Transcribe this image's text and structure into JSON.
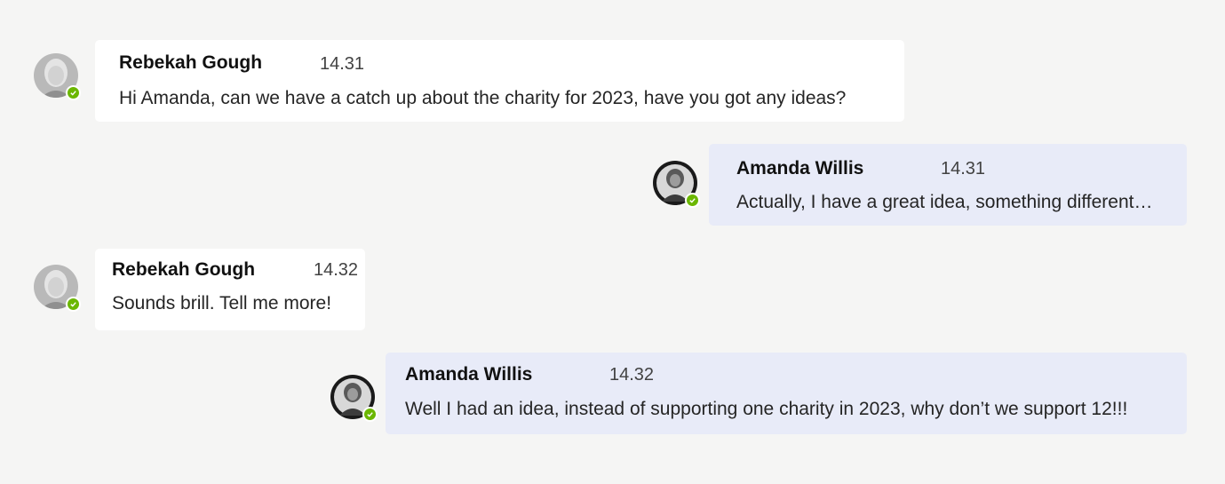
{
  "messages": [
    {
      "sender": "Rebekah Gough",
      "time": "14.31",
      "text": "Hi Amanda, can we have a catch up about the charity for 2023, have you got any ideas?",
      "status": "available"
    },
    {
      "sender": "Amanda Willis",
      "time": "14.31",
      "text": "Actually, I have a great idea, something different…",
      "status": "available"
    },
    {
      "sender": "Rebekah Gough",
      "time": "14.32",
      "text": "Sounds brill. Tell me more!",
      "status": "available"
    },
    {
      "sender": "Amanda Willis",
      "time": "14.32",
      "text": "Well I had an idea, instead of supporting one charity in 2023, why don’t we support 12!!!",
      "status": "available"
    }
  ],
  "colors": {
    "background": "#f5f5f4",
    "incoming_bubble": "#ffffff",
    "outgoing_bubble": "#e8ebf8",
    "presence_available": "#6bb700"
  },
  "icons": {
    "presence": "check-circle-icon"
  }
}
